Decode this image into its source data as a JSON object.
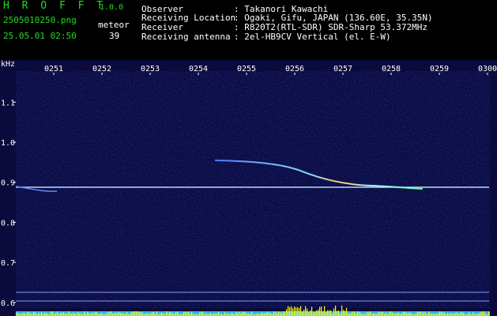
{
  "app": {
    "title": "H R O F F T",
    "version": "1.0.0",
    "filename": "2505010250.png",
    "datetime": "25.05.01 02:50",
    "meteor_label": "meteor",
    "meteor_count": "39"
  },
  "info": {
    "observer_label": "Observer",
    "observer_value": ": Takanori Kawachi",
    "location_label": "Receiving Location",
    "location_value": ": Ogaki, Gifu, JAPAN (136.60E, 35.35N)",
    "receiver_label": "Receiver",
    "receiver_value": ": R820T2(RTL-SDR) SDR-Sharp 53.372MHz",
    "antenna_label": "Receiving antenna",
    "antenna_value": ": 2el-HB9CV Vertical (el. E-W)"
  },
  "axis": {
    "unit": "kHz",
    "time_ticks": [
      "0251",
      "0252",
      "0253",
      "0254",
      "0255",
      "0256",
      "0257",
      "0258",
      "0259",
      "0300"
    ],
    "freq_ticks": [
      {
        "label": "1.1",
        "value": 1.1
      },
      {
        "label": "1.0",
        "value": 1.0
      },
      {
        "label": "0.9",
        "value": 0.9
      },
      {
        "label": "0.8",
        "value": 0.8
      },
      {
        "label": "0.7",
        "value": 0.7
      },
      {
        "label": "0.6",
        "value": 0.6
      }
    ]
  },
  "colors": {
    "background": "#0a0a3c",
    "carrier": "#b8d8ff",
    "meteor": "#99ffcc",
    "level_bar": "#ffff00",
    "level_base": "#2ab7ff",
    "header_green": "#22dd22"
  }
}
